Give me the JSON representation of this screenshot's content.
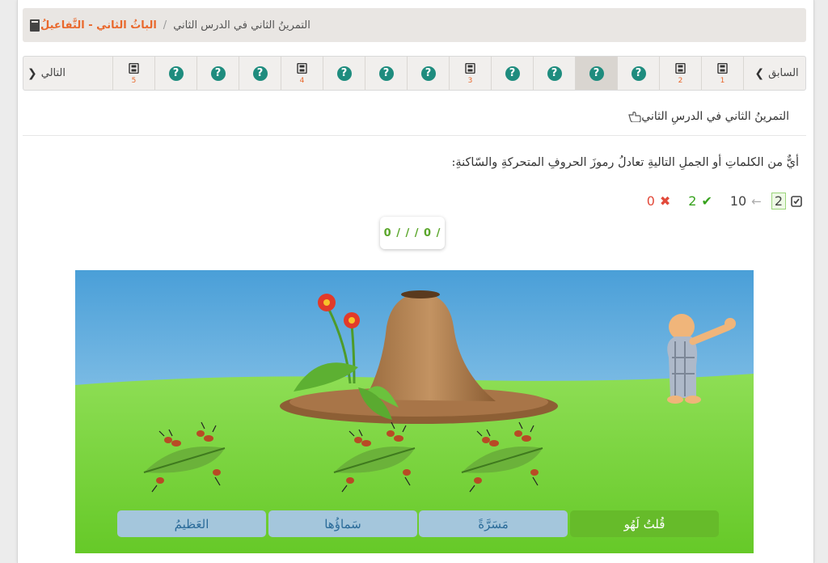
{
  "breadcrumb": {
    "chapter": "الباثُ الثاني - التَّفاعيلُ",
    "separator": "/",
    "current": "التمرينُ الثاني في الدرس الثاني"
  },
  "nav": {
    "prev_label": "السابق",
    "next_label": "التالي",
    "items": [
      {
        "type": "video",
        "num": "1"
      },
      {
        "type": "video",
        "num": "2"
      },
      {
        "type": "question",
        "num": ""
      },
      {
        "type": "question",
        "num": "",
        "active": true
      },
      {
        "type": "question",
        "num": ""
      },
      {
        "type": "question",
        "num": ""
      },
      {
        "type": "video",
        "num": "3"
      },
      {
        "type": "question",
        "num": ""
      },
      {
        "type": "question",
        "num": ""
      },
      {
        "type": "question",
        "num": ""
      },
      {
        "type": "video",
        "num": "4"
      },
      {
        "type": "question",
        "num": ""
      },
      {
        "type": "question",
        "num": ""
      },
      {
        "type": "question",
        "num": ""
      },
      {
        "type": "video",
        "num": "5"
      }
    ],
    "question_glyph": "?"
  },
  "exercise": {
    "title": "التمرينُ الثاني في الدرسِ الثاني",
    "question": "أيٌّ من الكلماتِ أو الجملِ التاليةِ تعادلُ رموزَ الحروفِ المتحركةِ والسّاكنةِ:"
  },
  "stats": {
    "current": "2",
    "arrow": "←",
    "total": "10",
    "correct": "2",
    "correct_icon": "✔",
    "wrong": "0",
    "wrong_icon": "✖"
  },
  "score_pattern": "0 / / / 0 /",
  "answers": [
    {
      "label": "قُلتُ لَهُو",
      "selected": true
    },
    {
      "label": "مَسَرَّةً",
      "selected": false
    },
    {
      "label": "سَماؤُها",
      "selected": false
    },
    {
      "label": "العَظيمُ",
      "selected": false
    }
  ],
  "colors": {
    "accent": "#e9682c",
    "question_icon": "#1e8c7e",
    "selected_answer": "#66bb2a",
    "answer_bg": "#a4c6dc",
    "correct": "#37a21d",
    "wrong": "#e24a3b"
  }
}
